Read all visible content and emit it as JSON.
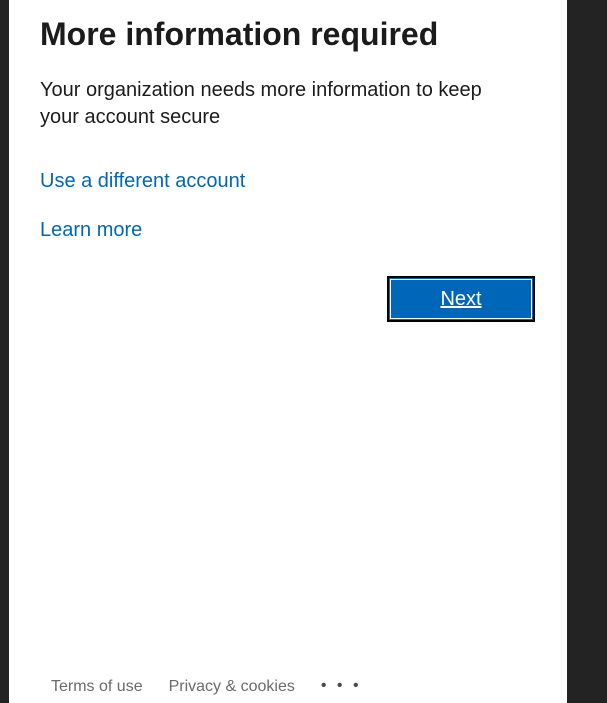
{
  "page": {
    "title": "More information required",
    "description": "Your organization needs more information to keep your account secure"
  },
  "links": {
    "different_account": "Use a different account",
    "learn_more": "Learn more"
  },
  "actions": {
    "next_label": "Next"
  },
  "footer": {
    "terms": "Terms of use",
    "privacy": "Privacy & cookies",
    "more": "• • •"
  },
  "colors": {
    "accent": "#0067b8",
    "background_side": "#232323",
    "text": "#1b1b1b"
  }
}
